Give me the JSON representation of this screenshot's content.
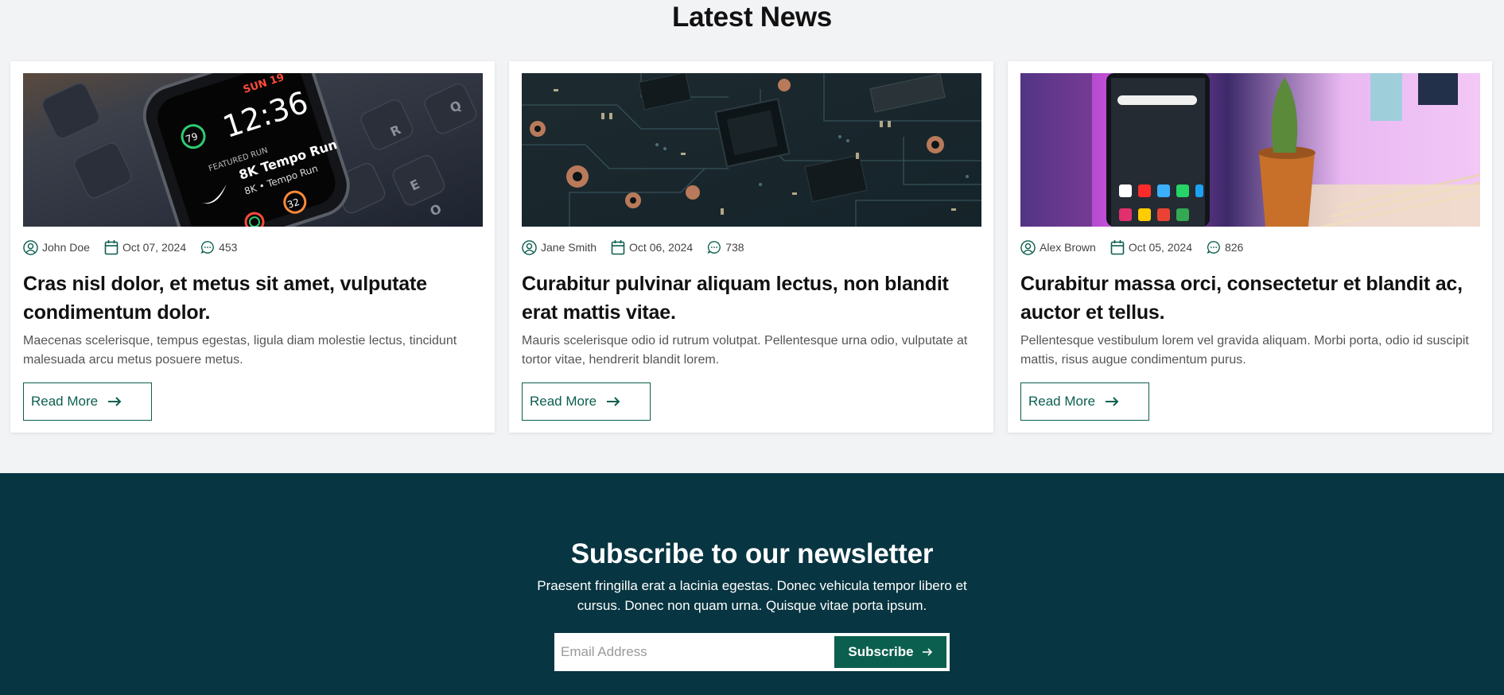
{
  "news": {
    "title": "Latest News",
    "cards": [
      {
        "image_name": "smartwatch-photo",
        "author": "John Doe",
        "date": "Oct 07, 2024",
        "comments": "453",
        "title": "Cras nisl dolor, et metus sit amet, vulputate condimentum dolor.",
        "excerpt": "Maecenas scelerisque, tempus egestas, ligula diam molestie lectus, tincidunt malesuada arcu metus posuere metus.",
        "button_label": "Read More",
        "watch": {
          "day": "SUN 19",
          "time": "12:36",
          "ring": "79",
          "run": "8K Tempo Run",
          "run2": "8K • Tempo Run",
          "stat": "32"
        }
      },
      {
        "image_name": "circuit-board-photo",
        "author": "Jane Smith",
        "date": "Oct 06, 2024",
        "comments": "738",
        "title": "Curabitur pulvinar aliquam lectus, non blandit erat mattis vitae.",
        "excerpt": "Mauris scelerisque odio id rutrum volutpat. Pellentesque urna odio, vulputate at tortor vitae, hendrerit blandit lorem.",
        "button_label": "Read More"
      },
      {
        "image_name": "smartphone-photo",
        "author": "Alex Brown",
        "date": "Oct 05, 2024",
        "comments": "826",
        "title": "Curabitur massa orci, consectetur et blandit ac, auctor et tellus.",
        "excerpt": "Pellentesque vestibulum lorem vel gravida aliquam. Morbi porta, odio id suscipit mattis, risus augue condimentum purus.",
        "button_label": "Read More"
      }
    ]
  },
  "newsletter": {
    "title": "Subscribe to our newsletter",
    "text": "Praesent fringilla erat a lacinia egestas. Donec vehicula tempor libero et cursus. Donec non quam urna. Quisque vitae porta ipsum.",
    "email_placeholder": "Email Address",
    "email_value": "",
    "button_label": "Subscribe"
  },
  "colors": {
    "accent": "#0b5f4e",
    "newsletter_bg": "#073541",
    "section_bg": "#f2f3f5"
  },
  "icons": [
    "user-icon",
    "calendar-icon",
    "comment-icon",
    "arrow-right-icon"
  ]
}
